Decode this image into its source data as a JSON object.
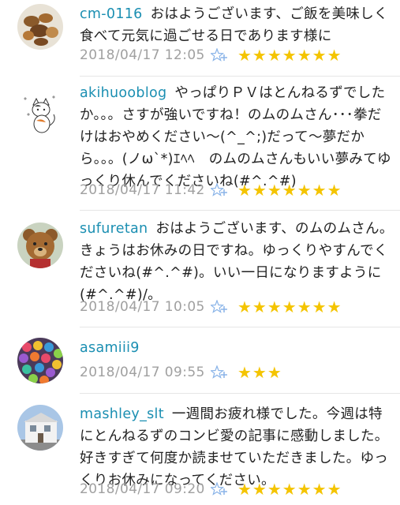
{
  "comments": [
    {
      "username": "cm-0116",
      "text": "おはようございます、ご飯を美味しく食べて元気に過ごせる日であります様に",
      "timestamp": "2018/04/17 12:05",
      "stars": "★★★★★★★",
      "avatar_icon": "nuts-photo-avatar"
    },
    {
      "username": "akihuooblog",
      "text": "やっぱりＰＶはとんねるずでしたか。。。さすが強いですね！のムのムさん･･･拳だけはおやめください〜(^_^;)だって〜夢だから。。。(ノω`*)ｴﾍﾍ　のムのムさんもいい夢みてゆっくり休んでくださいね(#^.^#)",
      "timestamp": "2018/04/17 11:42",
      "stars": "★★★★★★★",
      "avatar_icon": "cat-illustration-avatar"
    },
    {
      "username": "sufuretan",
      "text": "おはようございます、のムのムさん。きょうはお休みの日ですね。ゆっくりやすんでくださいね(#^.^#)。いい一日になりますように(#^.^#)/。",
      "timestamp": "2018/04/17 10:05",
      "stars": "★★★★★★★",
      "avatar_icon": "teddy-bear-avatar"
    },
    {
      "username": "asamiii9",
      "text": "",
      "timestamp": "2018/04/17 09:55",
      "stars": "★★★",
      "avatar_icon": "colorful-balls-avatar"
    },
    {
      "username": "mashley_slt",
      "text": "一週間お疲れ様でした。今週は特にとんねるずのコンビ愛の記事に感動しました。好きすぎて何度か読ませていただきました。ゆっくりお休みになってください。",
      "timestamp": "2018/04/17 09:20",
      "stars": "★★★★★★★",
      "avatar_icon": "house-photo-avatar"
    }
  ],
  "colors": {
    "username": "#1b8fb2",
    "star": "#f4c400",
    "timestamp": "#a0a0a0",
    "add_star_icon": "#8ab4e8"
  }
}
